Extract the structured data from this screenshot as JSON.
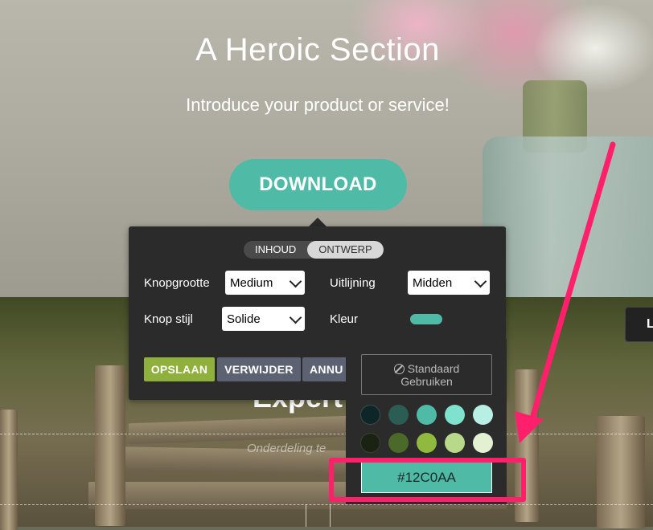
{
  "hero": {
    "title": "A Heroic Section",
    "subtitle": "Introduce your product or service!",
    "button_label": "DOWNLOAD"
  },
  "background_section": {
    "heading": "Expert",
    "subheading": "Onderdeling te",
    "side_button_label": "L"
  },
  "toolbar": {
    "tabs": [
      {
        "label": "INHOUD",
        "active": false
      },
      {
        "label": "ONTWERP",
        "active": true
      }
    ],
    "fields": {
      "size_label": "Knopgrootte",
      "size_value": "Medium",
      "align_label": "Uitlijning",
      "align_value": "Midden",
      "style_label": "Knop stijl",
      "style_value": "Solide",
      "color_label": "Kleur"
    },
    "actions": {
      "save": "OPSLAAN",
      "delete": "VERWIJDER",
      "cancel": "ANNU"
    }
  },
  "color_picker": {
    "default_line1": "Standaard",
    "default_line2": "Gebruiken",
    "swatches": [
      "#0e2628",
      "#2b5d54",
      "#4fbaa6",
      "#7ee2cf",
      "#b8efe4",
      "#1a2214",
      "#4b6a2a",
      "#8fba3e",
      "#b9d98a",
      "#e3f0d2"
    ],
    "hex_value": "#12C0AA"
  },
  "colors": {
    "accent": "#4fbaa6",
    "save_green": "#8fb03c",
    "highlight": "#ff1f6a"
  }
}
